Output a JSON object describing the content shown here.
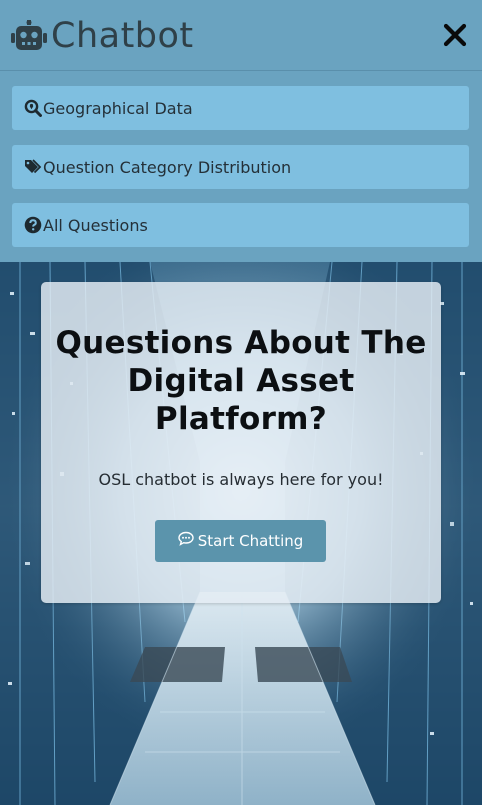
{
  "header": {
    "title": "Chatbot",
    "brand_icon": "robot-icon",
    "close_icon": "close-icon"
  },
  "menu": {
    "items": [
      {
        "label": "Geographical Data",
        "icon": "search-location-icon"
      },
      {
        "label": "Question Category Distribution",
        "icon": "tags-icon"
      },
      {
        "label": "All Questions",
        "icon": "question-circle-icon"
      }
    ]
  },
  "hero": {
    "title": "Questions About The Digital Asset Platform?",
    "subtitle": "OSL chatbot is always here for you!",
    "button_label": "Start Chatting",
    "button_icon": "comment-dots-icon"
  },
  "colors": {
    "header_bg": "#6aa3c0",
    "menu_item_bg": "#7fbfe0",
    "button_bg": "#5b94ac",
    "text_dark": "#2f4048"
  }
}
